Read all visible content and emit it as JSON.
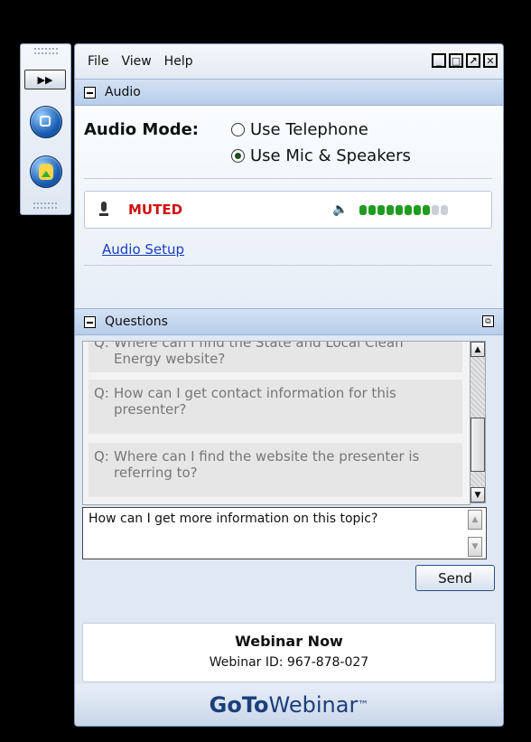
{
  "menu": {
    "file": "File",
    "view": "View",
    "help": "Help"
  },
  "audio": {
    "header": "Audio",
    "mode_label": "Audio Mode:",
    "options": [
      "Use Telephone",
      "Use Mic & Speakers"
    ],
    "selected_option": "Use Mic & Speakers",
    "mic_status": "MUTED",
    "speaker_level_fraction": 0.8,
    "setup_link": "Audio Setup"
  },
  "questions": {
    "header": "Questions",
    "items": [
      {
        "prefix": "Q:",
        "line1": "Where can I find the State and Local Clean",
        "line2": "Energy website?"
      },
      {
        "prefix": "Q:",
        "line1": "How can I get contact information for this",
        "line2": "presenter?"
      },
      {
        "prefix": "Q:",
        "line1": "Where can I find the website the presenter is",
        "line2": "referring to?"
      }
    ],
    "draft": "How can I get more information on this topic?",
    "send_label": "Send"
  },
  "footer": {
    "title": "Webinar Now",
    "webinar_id": "Webinar ID: 967-878-027",
    "brand_bold": "GoTo",
    "brand_rest": "Webinar",
    "brand_tm": "™"
  },
  "colors": {
    "muted": "#d01010",
    "meter_on": "#1f9c1f",
    "link": "#1a3fbf",
    "brand": "#1b3f7a"
  }
}
